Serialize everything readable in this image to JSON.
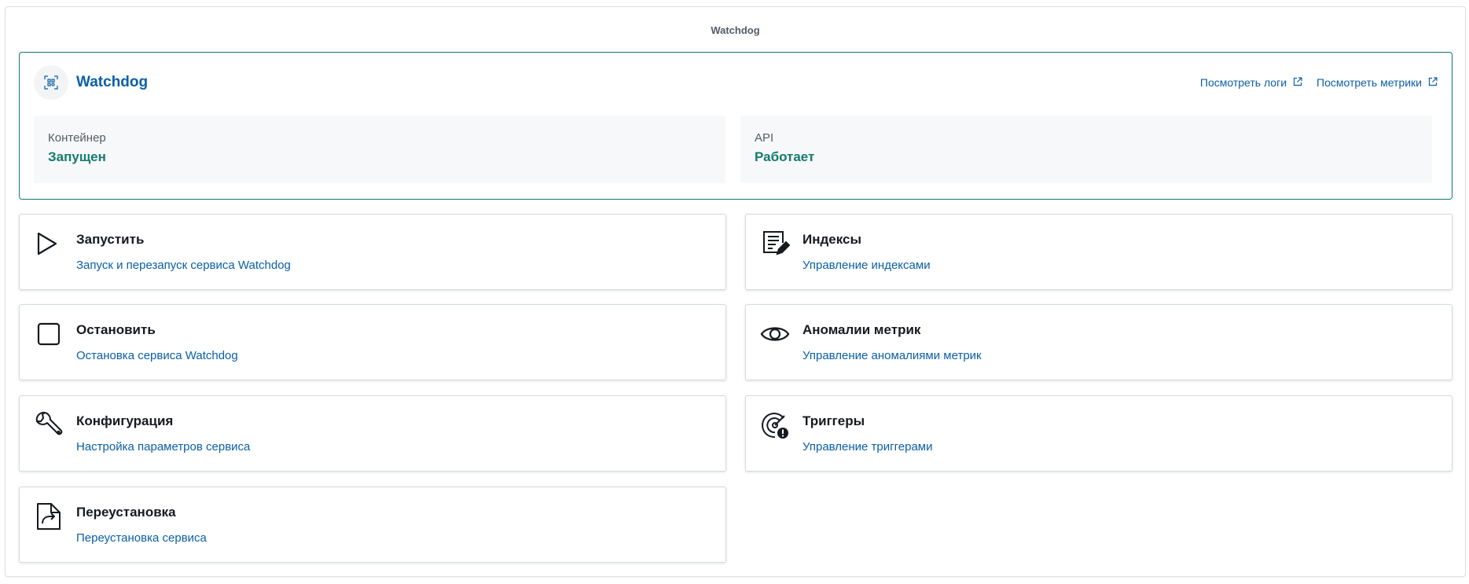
{
  "page": {
    "title": "Watchdog"
  },
  "status": {
    "service_name": "Watchdog",
    "service_icon": "scan-icon",
    "links": [
      {
        "label": "Посмотреть логи",
        "icon": "external-link-icon"
      },
      {
        "label": "Посмотреть метрики",
        "icon": "external-link-icon"
      }
    ],
    "container": {
      "label": "Контейнер",
      "value": "Запущен"
    },
    "api": {
      "label": "API",
      "value": "Работает"
    }
  },
  "actions": [
    {
      "title": "Запустить",
      "description": "Запуск и перезапуск сервиса Watchdog",
      "icon": "play-icon"
    },
    {
      "title": "Индексы",
      "description": "Управление индексами",
      "icon": "document-edit-icon"
    },
    {
      "title": "Остановить",
      "description": "Остановка сервиса Watchdog",
      "icon": "stop-icon"
    },
    {
      "title": "Аномалии метрик",
      "description": "Управление аномалиями метрик",
      "icon": "eye-icon"
    },
    {
      "title": "Конфигурация",
      "description": "Настройка параметров сервиса",
      "icon": "wrench-icon"
    },
    {
      "title": "Триггеры",
      "description": "Управление триггерами",
      "icon": "radar-alert-icon"
    },
    {
      "title": "Переустановка",
      "description": "Переустановка сервиса",
      "icon": "file-export-icon"
    }
  ],
  "colors": {
    "accent": "#137b6e",
    "link": "#0a5fa8",
    "border": "#d5dbdb"
  }
}
